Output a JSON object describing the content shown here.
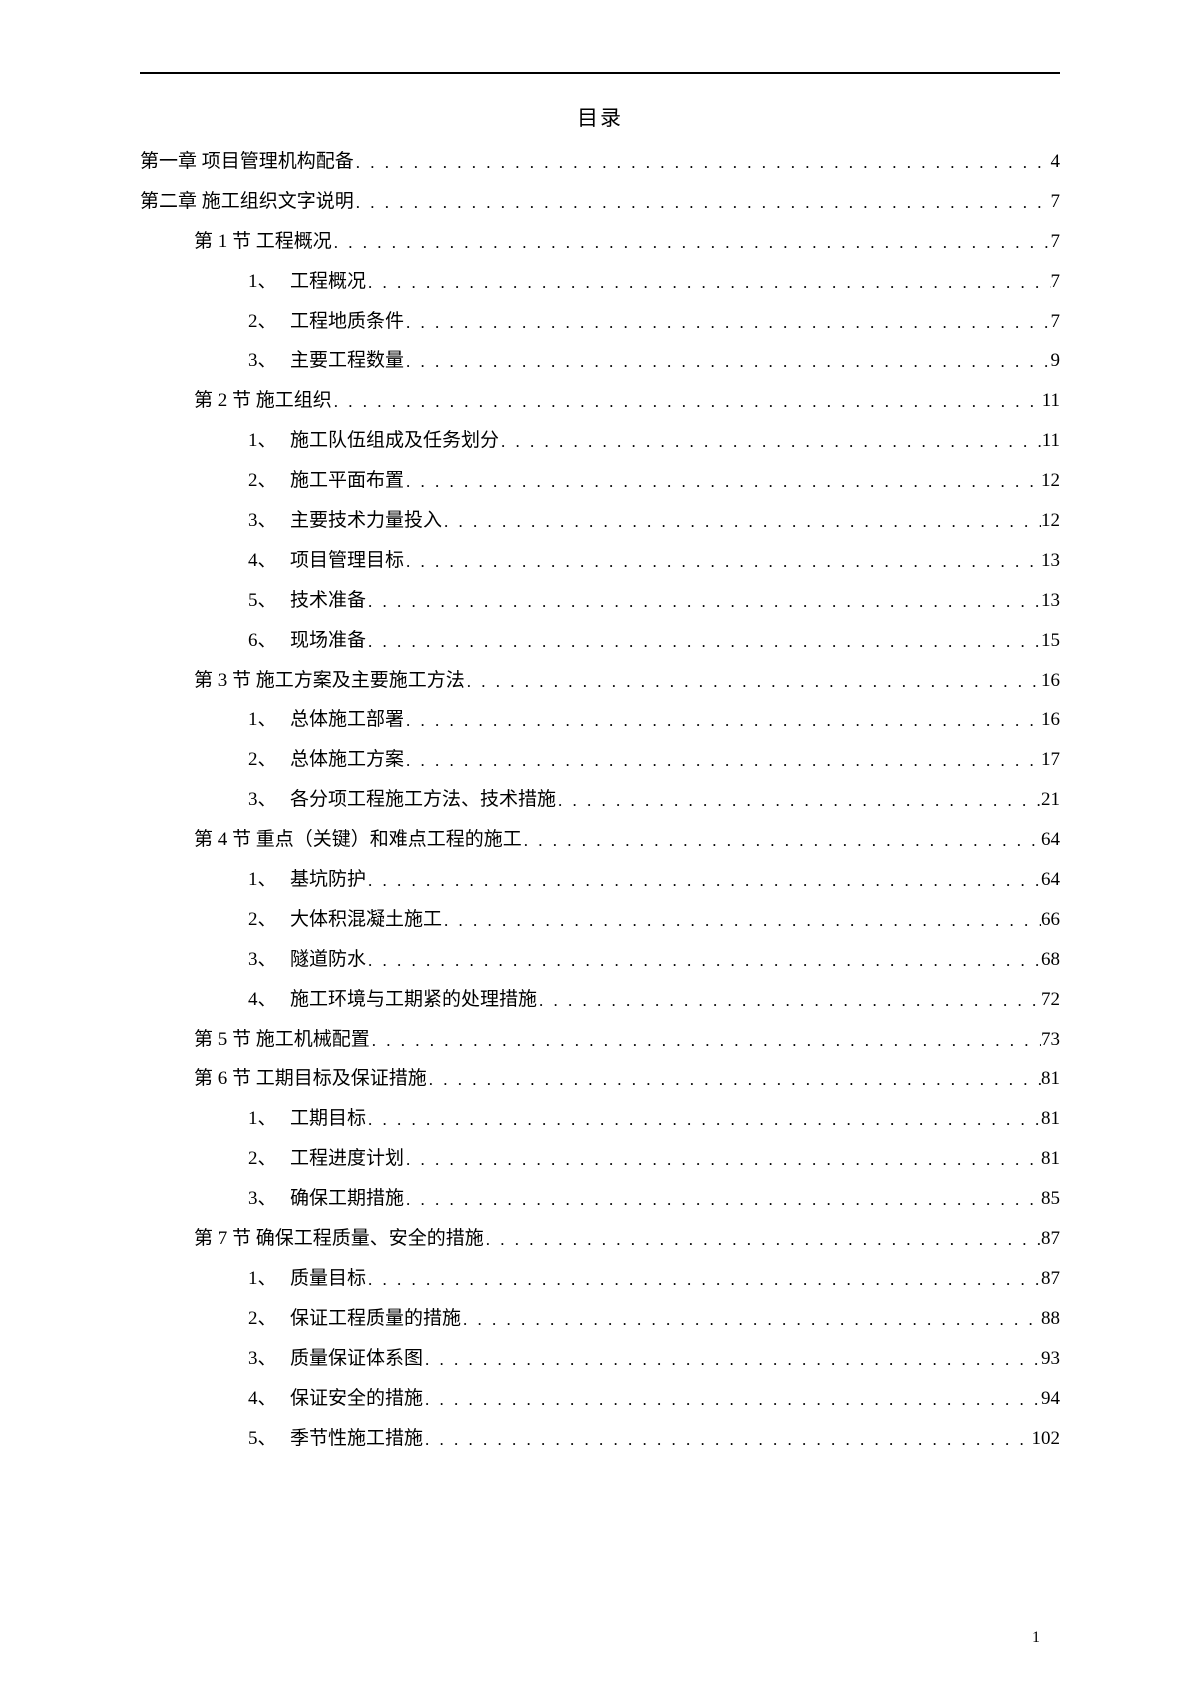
{
  "title": "目录",
  "page_number": "1",
  "entries": [
    {
      "level": 1,
      "text": "第一章 项目管理机构配备",
      "page": "4"
    },
    {
      "level": 1,
      "text": "第二章 施工组织文字说明",
      "page": "7"
    },
    {
      "level": 2,
      "text": "第 1 节 工程概况",
      "page": "7"
    },
    {
      "level": 3,
      "num": "1、",
      "text": "工程概况",
      "page": "7"
    },
    {
      "level": 3,
      "num": "2、",
      "text": "工程地质条件",
      "page": "7"
    },
    {
      "level": 3,
      "num": "3、",
      "text": "主要工程数量",
      "page": "9"
    },
    {
      "level": 2,
      "text": "第 2 节 施工组织",
      "page": "11"
    },
    {
      "level": 3,
      "num": "1、",
      "text": "施工队伍组成及任务划分",
      "page": "11"
    },
    {
      "level": 3,
      "num": "2、",
      "text": "施工平面布置",
      "page": "12"
    },
    {
      "level": 3,
      "num": "3、",
      "text": "主要技术力量投入",
      "page": "12"
    },
    {
      "level": 3,
      "num": "4、",
      "text": "项目管理目标",
      "page": "13"
    },
    {
      "level": 3,
      "num": "5、",
      "text": "技术准备",
      "page": "13"
    },
    {
      "level": 3,
      "num": "6、",
      "text": "现场准备",
      "page": "15"
    },
    {
      "level": 2,
      "text": "第 3 节 施工方案及主要施工方法",
      "page": "16"
    },
    {
      "level": 3,
      "num": "1、",
      "text": "总体施工部署",
      "page": "16"
    },
    {
      "level": 3,
      "num": "2、",
      "text": "总体施工方案",
      "page": "17"
    },
    {
      "level": 3,
      "num": "3、",
      "text": "各分项工程施工方法、技术措施",
      "page": "21"
    },
    {
      "level": 2,
      "text": "第 4 节 重点（关键）和难点工程的施工",
      "page": "64"
    },
    {
      "level": 3,
      "num": "1、",
      "text": "基坑防护",
      "page": "64"
    },
    {
      "level": 3,
      "num": "2、",
      "text": "大体积混凝土施工",
      "page": "66"
    },
    {
      "level": 3,
      "num": "3、",
      "text": "隧道防水",
      "page": "68"
    },
    {
      "level": 3,
      "num": "4、",
      "text": "施工环境与工期紧的处理措施",
      "page": "72"
    },
    {
      "level": 2,
      "text": "第 5 节 施工机械配置",
      "page": "73"
    },
    {
      "level": 2,
      "text": "第 6 节 工期目标及保证措施",
      "page": "81"
    },
    {
      "level": 3,
      "num": "1、",
      "text": "工期目标",
      "page": "81"
    },
    {
      "level": 3,
      "num": "2、",
      "text": "工程进度计划",
      "page": "81"
    },
    {
      "level": 3,
      "num": "3、",
      "text": "确保工期措施",
      "page": "85"
    },
    {
      "level": 2,
      "text": "第 7 节 确保工程质量、安全的措施",
      "page": "87"
    },
    {
      "level": 3,
      "num": "1、",
      "text": "质量目标",
      "page": "87"
    },
    {
      "level": 3,
      "num": "2、",
      "text": "保证工程质量的措施",
      "page": "88"
    },
    {
      "level": 3,
      "num": "3、",
      "text": "质量保证体系图",
      "page": "93"
    },
    {
      "level": 3,
      "num": "4、",
      "text": "保证安全的措施",
      "page": "94"
    },
    {
      "level": 3,
      "num": "5、",
      "text": "季节性施工措施",
      "page": "102"
    }
  ]
}
